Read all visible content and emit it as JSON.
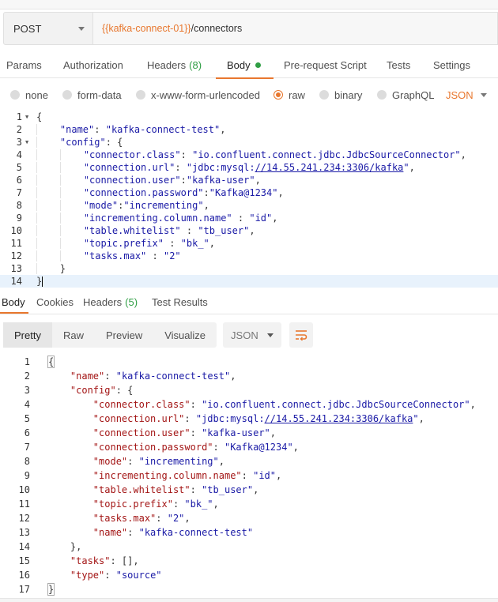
{
  "request": {
    "method": "POST",
    "url_variable": "{{kafka-connect-01}}",
    "url_path": "/connectors"
  },
  "request_tabs": [
    {
      "label": "Params"
    },
    {
      "label": "Authorization"
    },
    {
      "label": "Headers",
      "count": "(8)"
    },
    {
      "label": "Body"
    },
    {
      "label": "Pre-request Script"
    },
    {
      "label": "Tests"
    },
    {
      "label": "Settings"
    }
  ],
  "body_types": [
    "none",
    "form-data",
    "x-www-form-urlencoded",
    "raw",
    "binary",
    "GraphQL"
  ],
  "body_selected": "raw",
  "body_language": "JSON",
  "request_body_lines": [
    "{",
    "\"name\": \"kafka-connect-test\",",
    "\"config\": {",
    "\"connector.class\": \"io.confluent.connect.jdbc.JdbcSourceConnector\",",
    "\"connection.url\": \"jdbc:mysql://14.55.241.234:3306/kafka\",",
    "\"connection.user\":\"kafka-user\",",
    "\"connection.password\":\"Kafka@1234\",",
    "\"mode\":\"incrementing\",",
    "\"incrementing.column.name\" : \"id\",",
    "\"table.whitelist\" : \"tb_user\",",
    "\"topic.prefix\" : \"bk_\",",
    "\"tasks.max\" : \"2\"",
    "}",
    "}"
  ],
  "response_tabs": [
    {
      "label": "Body"
    },
    {
      "label": "Cookies"
    },
    {
      "label": "Headers",
      "count": "(5)"
    },
    {
      "label": "Test Results"
    }
  ],
  "view_modes": [
    "Pretty",
    "Raw",
    "Preview",
    "Visualize"
  ],
  "response_format": "JSON",
  "response_lines": [
    "{",
    "\"name\": \"kafka-connect-test\",",
    "\"config\": {",
    "\"connector.class\": \"io.confluent.connect.jdbc.JdbcSourceConnector\",",
    "\"connection.url\": \"jdbc:mysql://14.55.241.234:3306/kafka\",",
    "\"connection.user\": \"kafka-user\",",
    "\"connection.password\": \"Kafka@1234\",",
    "\"mode\": \"incrementing\",",
    "\"incrementing.column.name\": \"id\",",
    "\"table.whitelist\": \"tb_user\",",
    "\"topic.prefix\": \"bk_\",",
    "\"tasks.max\": \"2\",",
    "\"name\": \"kafka-connect-test\"",
    "},",
    "\"tasks\": [],",
    "\"type\": \"source\"",
    "}"
  ],
  "colors": {
    "accent": "#e8772e",
    "success": "#2f9e44",
    "json_key": "#a31515",
    "json_string": "#1a1aa6"
  }
}
